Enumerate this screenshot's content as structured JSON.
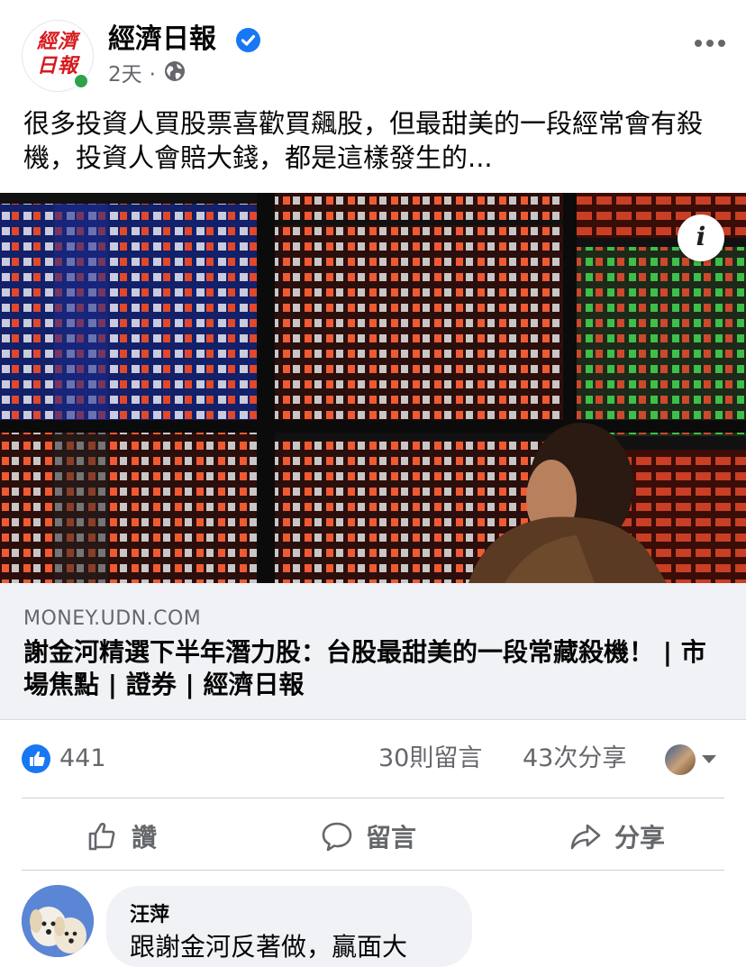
{
  "header": {
    "logo_text": "經濟日報",
    "page_name": "經濟日報",
    "time_ago": "2天",
    "separator": "·",
    "verified_icon": "verified-badge-icon",
    "privacy_icon": "globe-icon",
    "more_icon": "more-options-icon"
  },
  "post": {
    "caption": "很多投資人買股票喜歡買飆股，但最甜美的一段經常會有殺機，投資人會賠大錢，都是這樣發生的..."
  },
  "link_preview": {
    "image_description": "stock-board-photo",
    "info_badge": "i",
    "domain": "MONEY.UDN.COM",
    "title": "謝金河精選下半年潛力股：台股最甜美的一段常藏殺機！ | 市場焦點 | 證券 | 經濟日報"
  },
  "engagement": {
    "reaction_icon": "like-reaction-icon",
    "like_count": "441",
    "comment_count": "30則留言",
    "share_count": "43次分享"
  },
  "actions": {
    "like_label": "讚",
    "comment_label": "留言",
    "share_label": "分享"
  },
  "comments": [
    {
      "author": "汪萍",
      "text": "跟謝金河反著做，贏面大"
    }
  ],
  "colors": {
    "accent": "#1877f2",
    "secondary_text": "#65676b",
    "online": "#31a24c",
    "logo_red": "#d7191d"
  }
}
